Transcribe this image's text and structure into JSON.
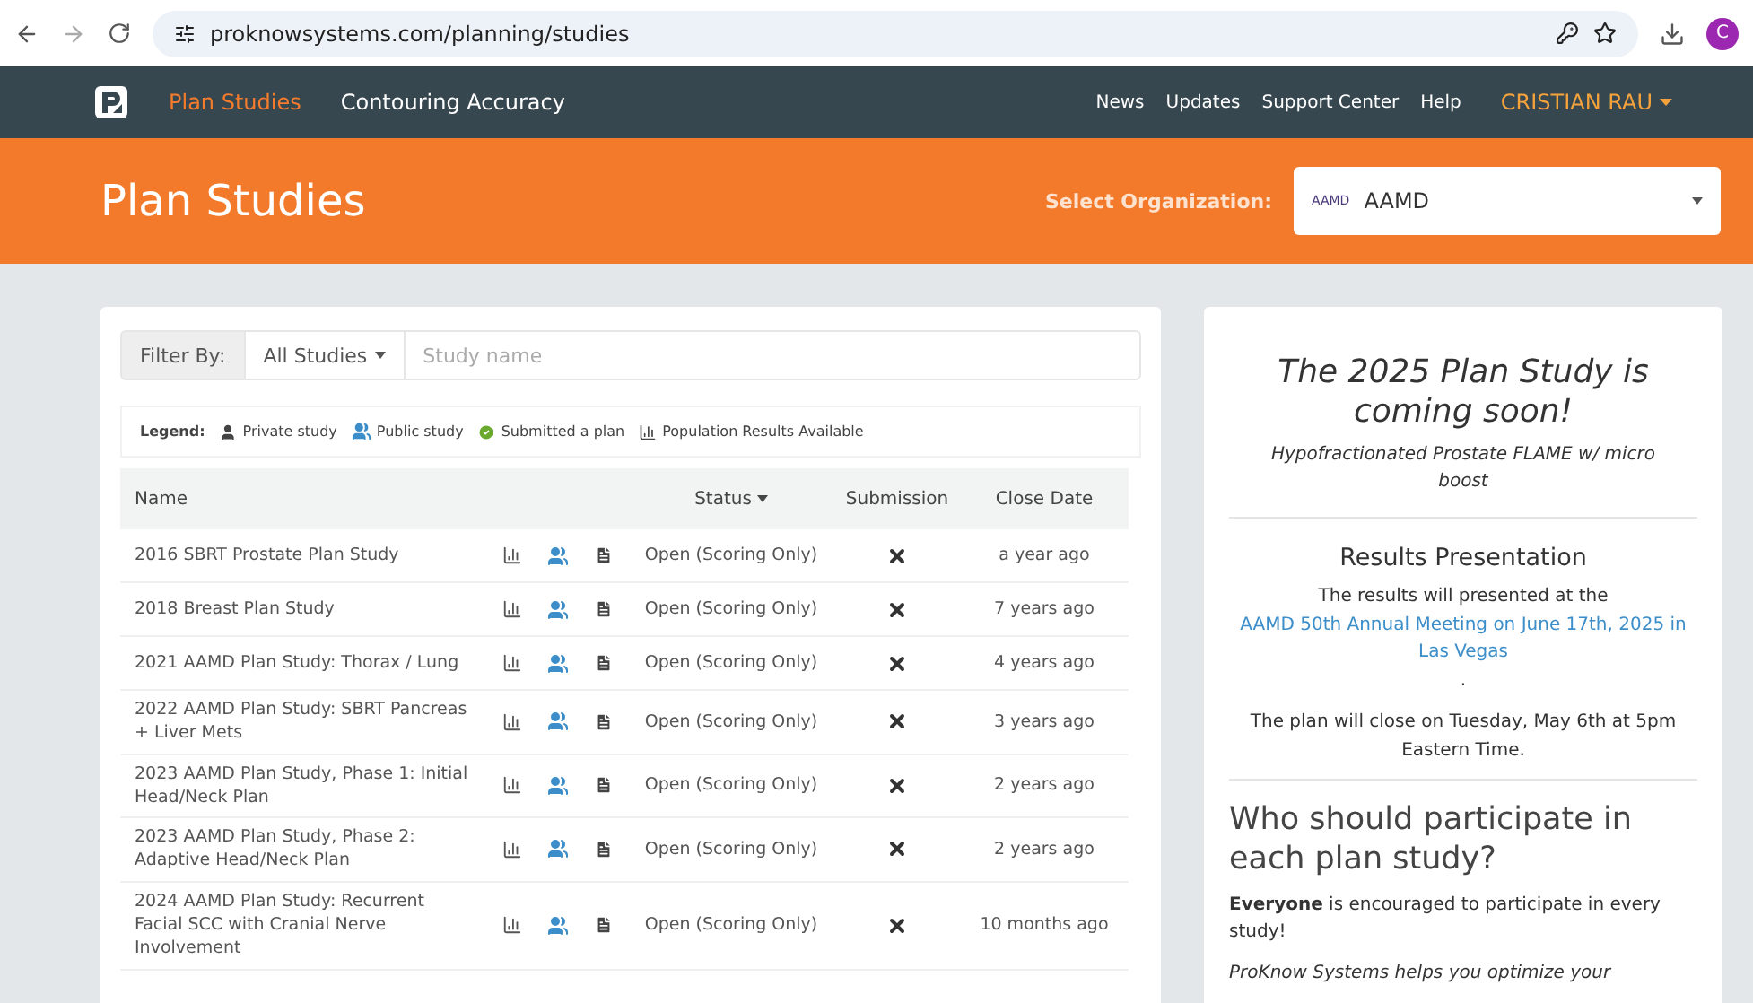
{
  "browser": {
    "url": "proknowsystems.com/planning/studies",
    "profile": "C"
  },
  "nav": {
    "items": [
      {
        "label": "Plan Studies",
        "selected": true
      },
      {
        "label": "Contouring Accuracy",
        "selected": false
      }
    ],
    "links": [
      "News",
      "Updates",
      "Support Center",
      "Help"
    ],
    "user": "CRISTIAN RAU"
  },
  "header": {
    "title": "Plan Studies",
    "org_label": "Select Organization:",
    "org_logo": "AAMD",
    "org_value": "AAMD"
  },
  "filter": {
    "label": "Filter By:",
    "dropdown": "All Studies",
    "placeholder": "Study name"
  },
  "legend": {
    "label": "Legend:",
    "items": [
      {
        "kind": "private",
        "text": "Private study"
      },
      {
        "kind": "public",
        "text": "Public study"
      },
      {
        "kind": "submitted",
        "text": "Submitted a plan"
      },
      {
        "kind": "results",
        "text": "Population Results Available"
      }
    ]
  },
  "table": {
    "columns": [
      "Name",
      "Status",
      "Submission",
      "Close Date"
    ],
    "rows": [
      {
        "name": "2016 SBRT Prostate Plan Study",
        "status": "Open (Scoring Only)",
        "submitted": false,
        "close": "a year ago"
      },
      {
        "name": "2018 Breast Plan Study",
        "status": "Open (Scoring Only)",
        "submitted": false,
        "close": "7 years ago"
      },
      {
        "name": "2021 AAMD Plan Study: Thorax / Lung",
        "status": "Open (Scoring Only)",
        "submitted": false,
        "close": "4 years ago"
      },
      {
        "name": "2022 AAMD Plan Study: SBRT Pancreas + Liver Mets",
        "status": "Open (Scoring Only)",
        "submitted": false,
        "close": "3 years ago"
      },
      {
        "name": "2023 AAMD Plan Study, Phase 1: Initial Head/Neck Plan",
        "status": "Open (Scoring Only)",
        "submitted": false,
        "close": "2 years ago"
      },
      {
        "name": "2023 AAMD Plan Study, Phase 2: Adaptive Head/Neck Plan",
        "status": "Open (Scoring Only)",
        "submitted": false,
        "close": "2 years ago"
      },
      {
        "name": "2024 AAMD Plan Study: Recurrent Facial SCC with Cranial Nerve Involvement",
        "status": "Open (Scoring Only)",
        "submitted": false,
        "close": "10 months ago"
      }
    ]
  },
  "aside": {
    "title": "The 2025 Plan Study is coming soon!",
    "subtitle": "Hypofractionated Prostate FLAME w/ micro boost",
    "results_heading": "Results Presentation",
    "results_before": "The results will presented at the ",
    "results_link": "AAMD 50th Annual Meeting on June 17th, 2025 in Las Vegas",
    "results_after": ".",
    "close_note": "The plan will close on Tuesday, May 6th at 5pm Eastern Time.",
    "who_heading": "Who should participate in each plan study?",
    "everyone": "**Everyone** is encouraged to participate in every study!",
    "proknow": "ProKnow Systems helps you optimize your"
  }
}
